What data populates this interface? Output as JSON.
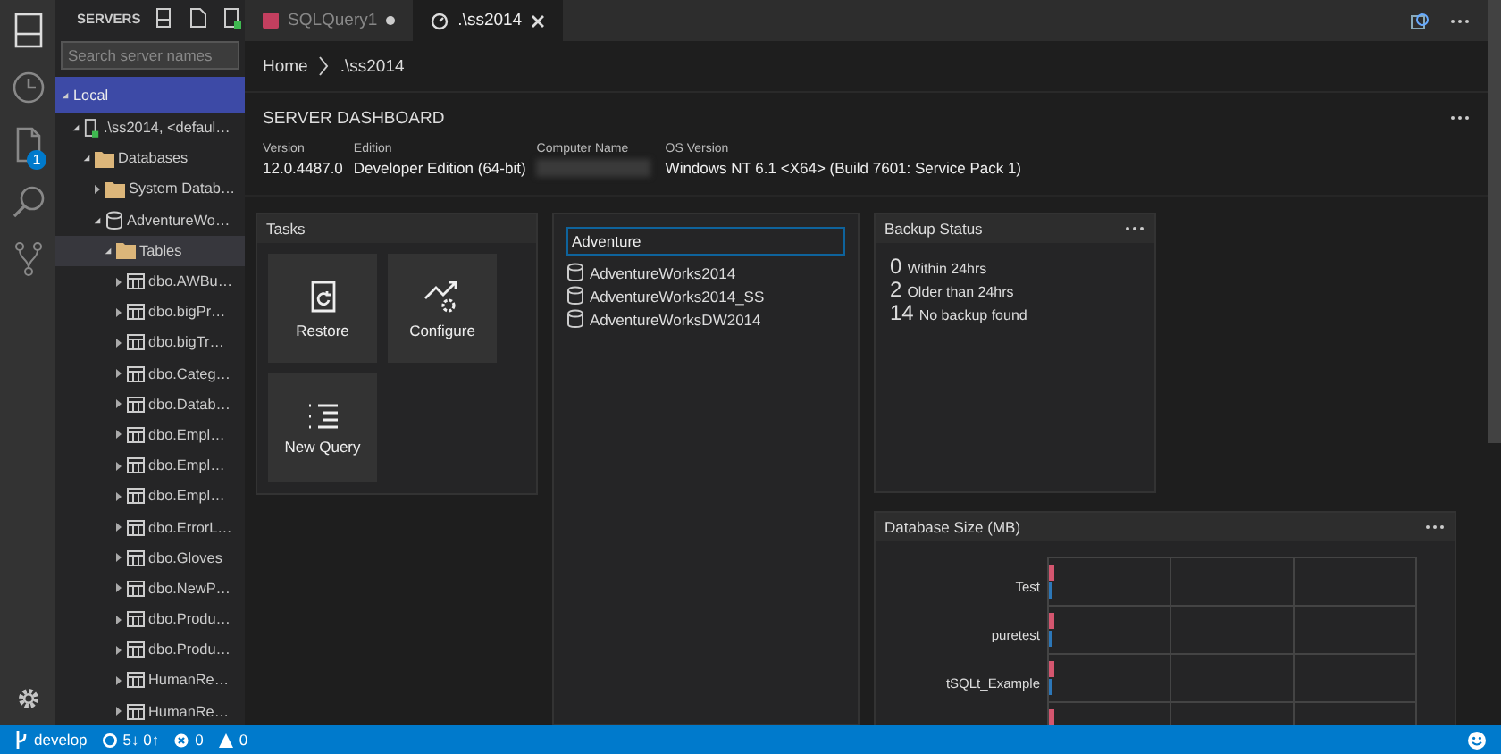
{
  "activity_bar": {
    "items": [
      {
        "kind": "servers",
        "selected": true
      },
      {
        "kind": "history",
        "selected": false
      },
      {
        "kind": "file",
        "selected": false,
        "badge": "1"
      },
      {
        "kind": "search",
        "selected": false
      },
      {
        "kind": "branch",
        "selected": false
      }
    ],
    "bottom": {
      "kind": "gear"
    }
  },
  "sidebar": {
    "title": "SERVERS",
    "search": {
      "placeholder": "Search server names"
    },
    "tree": [
      {
        "label": "Local",
        "kind": "group",
        "expanded": true,
        "selected": false,
        "children": [
          {
            "label": ".\\ss2014, <defaul…",
            "kind": "server",
            "connected": true,
            "expanded": true,
            "selected": false,
            "children": [
              {
                "label": "Databases",
                "kind": "folder",
                "expanded": true,
                "selected": false,
                "children": [
                  {
                    "label": "System Datab…",
                    "kind": "folder",
                    "expanded": false,
                    "selected": false
                  },
                  {
                    "label": "AdventureWo…",
                    "kind": "database",
                    "expanded": true,
                    "selected": false,
                    "children": [
                      {
                        "label": "Tables",
                        "kind": "folder",
                        "expanded": true,
                        "selected": true,
                        "children": [
                          {
                            "label": "dbo.AWBu…",
                            "kind": "table",
                            "expanded": false,
                            "selected": false
                          },
                          {
                            "label": "dbo.bigPr…",
                            "kind": "table",
                            "expanded": false,
                            "selected": false
                          },
                          {
                            "label": "dbo.bigTr…",
                            "kind": "table",
                            "expanded": false,
                            "selected": false
                          },
                          {
                            "label": "dbo.Categ…",
                            "kind": "table",
                            "expanded": false,
                            "selected": false
                          },
                          {
                            "label": "dbo.Datab…",
                            "kind": "table",
                            "expanded": false,
                            "selected": false
                          },
                          {
                            "label": "dbo.Empl…",
                            "kind": "table",
                            "expanded": false,
                            "selected": false
                          },
                          {
                            "label": "dbo.Empl…",
                            "kind": "table",
                            "expanded": false,
                            "selected": false
                          },
                          {
                            "label": "dbo.Empl…",
                            "kind": "table",
                            "expanded": false,
                            "selected": false
                          },
                          {
                            "label": "dbo.ErrorL…",
                            "kind": "table",
                            "expanded": false,
                            "selected": false
                          },
                          {
                            "label": "dbo.Gloves",
                            "kind": "table",
                            "expanded": false,
                            "selected": false
                          },
                          {
                            "label": "dbo.NewP…",
                            "kind": "table",
                            "expanded": false,
                            "selected": false
                          },
                          {
                            "label": "dbo.Produ…",
                            "kind": "table",
                            "expanded": false,
                            "selected": false
                          },
                          {
                            "label": "dbo.Produ…",
                            "kind": "table",
                            "expanded": false,
                            "selected": false
                          },
                          {
                            "label": "HumanRe…",
                            "kind": "table",
                            "expanded": false,
                            "selected": false
                          },
                          {
                            "label": "HumanRe…",
                            "kind": "table",
                            "expanded": false,
                            "selected": false
                          }
                        ]
                      }
                    ]
                  }
                ]
              }
            ]
          }
        ]
      }
    ]
  },
  "tabs": [
    {
      "label": "SQLQuery1",
      "kind": "query",
      "selected": false,
      "modified": true
    },
    {
      "label": ".\\ss2014",
      "kind": "dashboard",
      "selected": true,
      "modified": false
    }
  ],
  "breadcrumb": [
    "Home",
    ".\\ss2014"
  ],
  "dashboard": {
    "title": "SERVER DASHBOARD",
    "properties": [
      {
        "label": "Version",
        "value": "12.0.4487.0"
      },
      {
        "label": "Edition",
        "value": "Developer Edition (64-bit)"
      },
      {
        "label": "Computer Name",
        "blurred": true
      },
      {
        "label": "OS Version",
        "value": "Windows NT 6.1 <X64> (Build 7601: Service Pack 1)"
      }
    ]
  },
  "tasks": {
    "title": "Tasks",
    "items": [
      {
        "label": "Restore",
        "kind": "restore"
      },
      {
        "label": "Configure",
        "kind": "configure"
      },
      {
        "label": "New Query",
        "kind": "query"
      }
    ]
  },
  "database_search": {
    "value": "Adventure",
    "results": [
      "AdventureWorks2014",
      "AdventureWorks2014_SS",
      "AdventureWorksDW2014"
    ]
  },
  "backup_status": {
    "title": "Backup Status",
    "rows": [
      {
        "count": "0",
        "label": "Within 24hrs"
      },
      {
        "count": "2",
        "label": "Older than 24hrs"
      },
      {
        "count": "14",
        "label": "No backup found"
      }
    ]
  },
  "database_size": {
    "title": "Database Size (MB)",
    "labels": [
      "Test",
      "puretest",
      "tSQLt_Example"
    ]
  },
  "status_bar": {
    "branch": "develop",
    "sync": "5↓ 0↑",
    "errors": "0",
    "warnings": "0"
  }
}
